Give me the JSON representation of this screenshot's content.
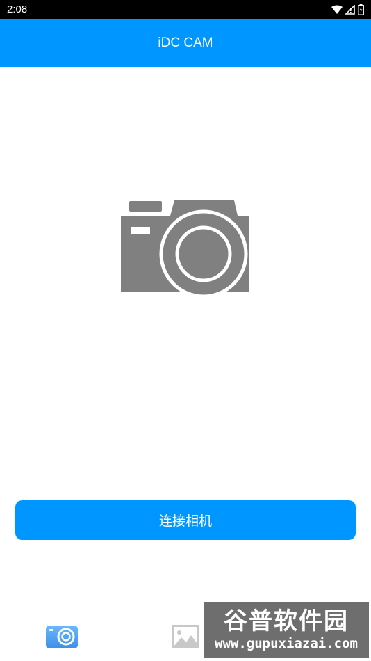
{
  "status_bar": {
    "time": "2:08",
    "icons": [
      "wifi-icon",
      "signal-icon",
      "battery-icon"
    ]
  },
  "app_bar": {
    "title": "iDC CAM"
  },
  "main": {
    "illustration_icon": "camera-icon",
    "connect_button_label": "连接相机"
  },
  "bottom_nav": {
    "items": [
      {
        "icon": "camera-app-icon",
        "active": true
      },
      {
        "icon": "gallery-icon",
        "active": false
      }
    ]
  },
  "watermark": {
    "title": "谷普软件园",
    "url": "www.gupuxiazai.com"
  },
  "colors": {
    "primary": "#0096ff",
    "illustration": "#808080",
    "status_bar": "#000000"
  }
}
